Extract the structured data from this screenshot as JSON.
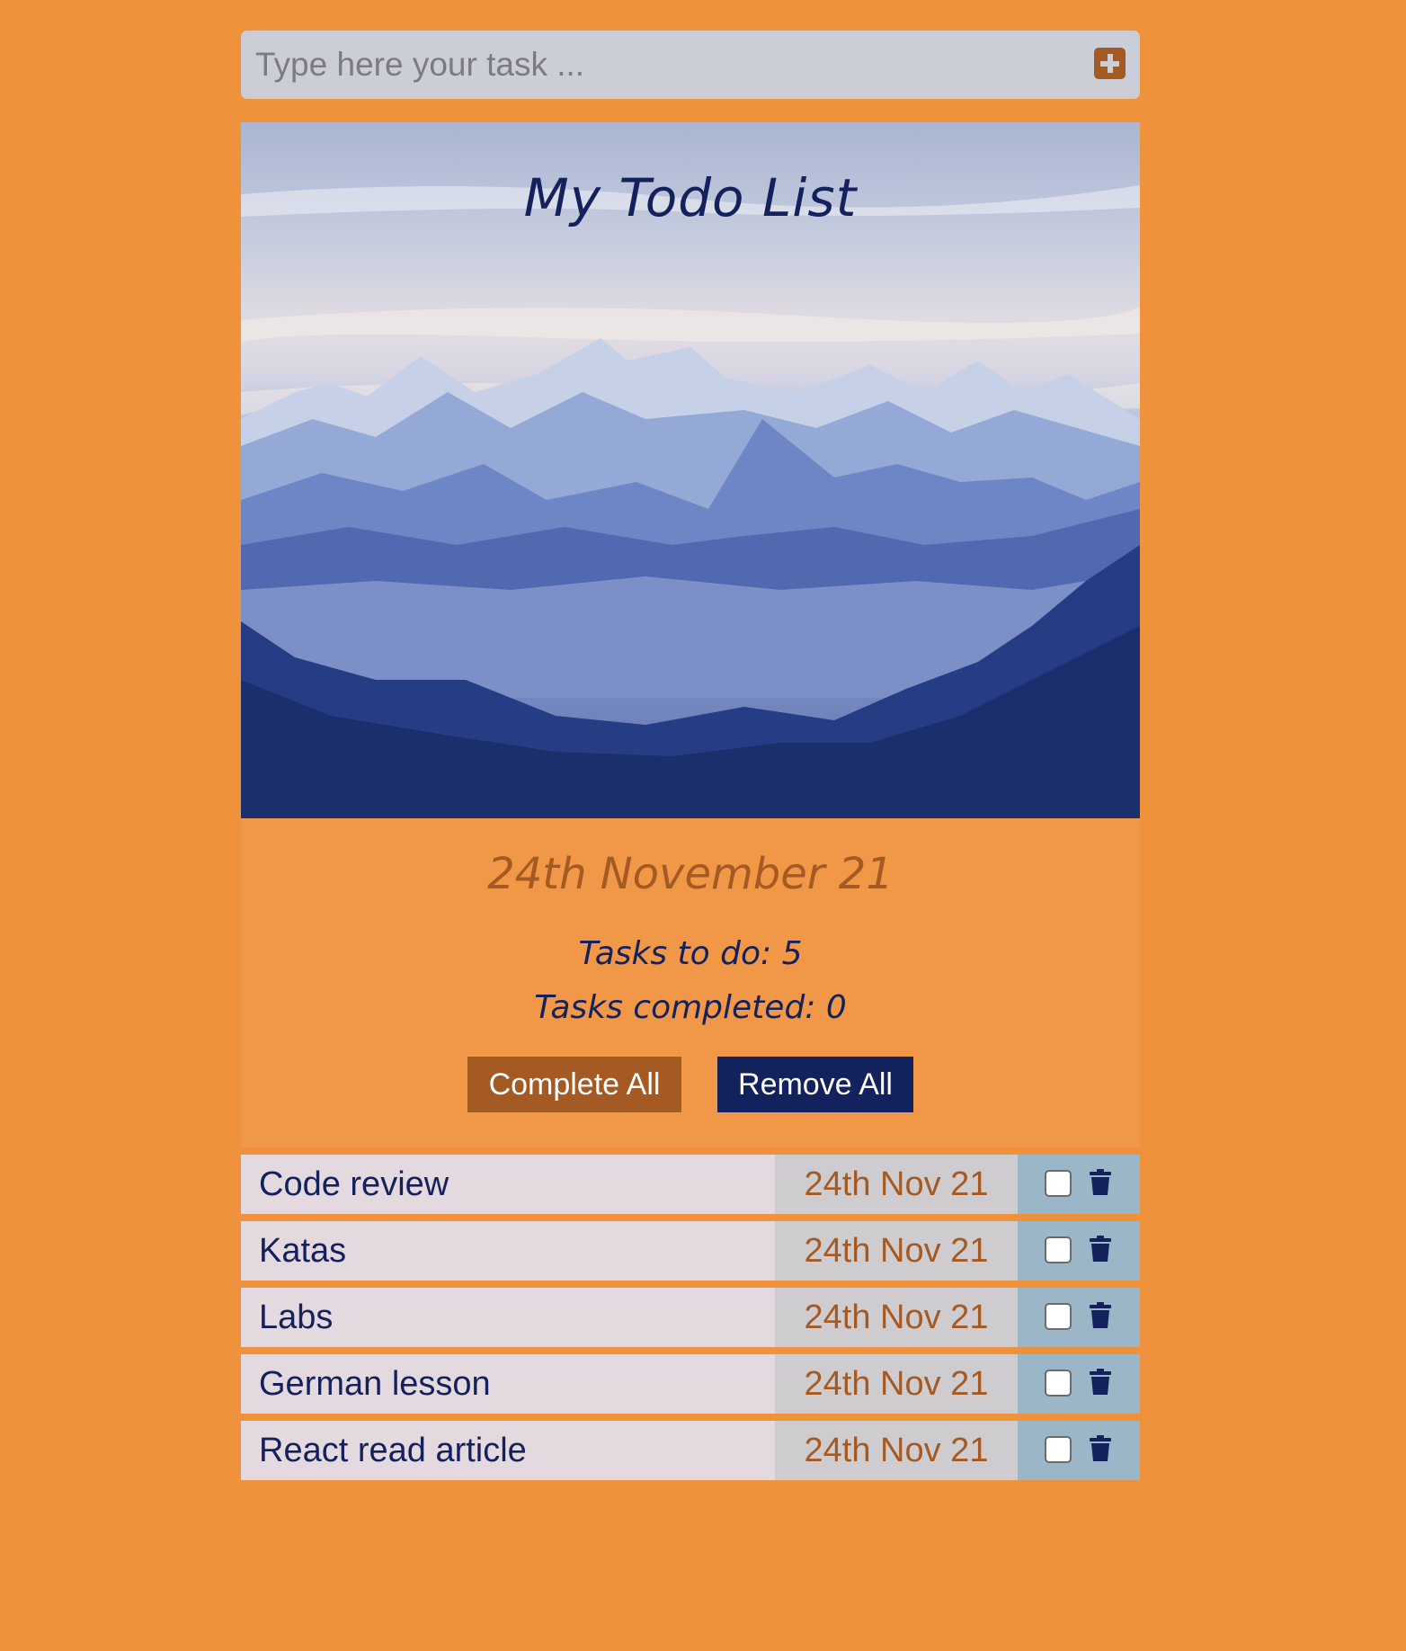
{
  "input": {
    "placeholder": "Type here your task ...",
    "add_icon": "plus-square-icon"
  },
  "header": {
    "title": "My Todo List",
    "background": "mountain-landscape"
  },
  "summary": {
    "date": "24th November 21",
    "tasks_to_do": "Tasks to do: 5",
    "tasks_completed": "Tasks completed: 0",
    "complete_all_label": "Complete All",
    "remove_all_label": "Remove All"
  },
  "tasks": [
    {
      "name": "Code review",
      "date": "24th Nov 21",
      "completed": false
    },
    {
      "name": "Katas",
      "date": "24th Nov 21",
      "completed": false
    },
    {
      "name": "Labs",
      "date": "24th Nov 21",
      "completed": false
    },
    {
      "name": "German lesson",
      "date": "24th Nov 21",
      "completed": false
    },
    {
      "name": "React read article",
      "date": "24th Nov 21",
      "completed": false
    }
  ],
  "colors": {
    "page_background": "#f0913c",
    "accent_brown": "#a45a22",
    "navy": "#13215c",
    "task_name_bg": "#e3d9de",
    "task_date_bg": "#cfcccf",
    "task_actions_bg": "#9bb6c6"
  }
}
